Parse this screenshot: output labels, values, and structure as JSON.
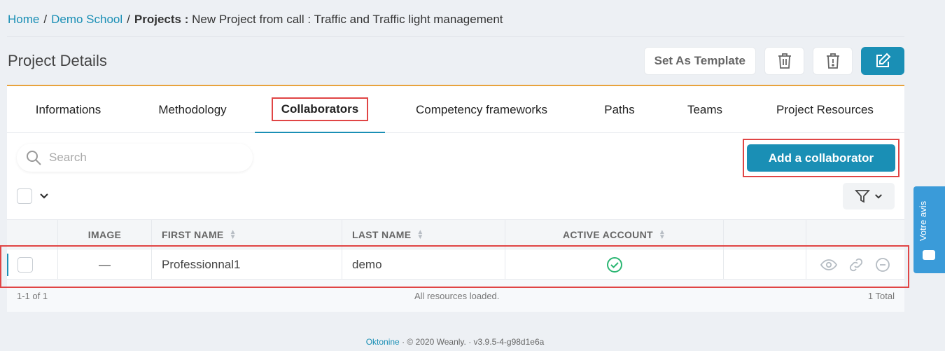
{
  "breadcrumb": {
    "home": "Home",
    "school": "Demo School",
    "section": "Projects :",
    "current": "New Project from call : Traffic and Traffic light management"
  },
  "page": {
    "title": "Project Details"
  },
  "toolbar": {
    "template_label": "Set As Template"
  },
  "tabs": [
    {
      "label": "Informations"
    },
    {
      "label": "Methodology"
    },
    {
      "label": "Collaborators"
    },
    {
      "label": "Competency frameworks"
    },
    {
      "label": "Paths"
    },
    {
      "label": "Teams"
    },
    {
      "label": "Project Resources"
    }
  ],
  "active_tab": "Collaborators",
  "search": {
    "placeholder": "Search"
  },
  "add_button": "Add a collaborator",
  "table": {
    "headers": [
      "IMAGE",
      "FIRST NAME",
      "LAST NAME",
      "ACTIVE ACCOUNT"
    ],
    "rows": [
      {
        "image": "—",
        "first_name": "Professionnal1",
        "last_name": "demo",
        "active": true
      }
    ],
    "footer": {
      "range": "1-1 of 1",
      "status": "All resources loaded.",
      "total": "1 Total"
    }
  },
  "footer": {
    "brand": "Oktonine",
    "copyright": "© 2020 Weanly.",
    "version": "v3.9.5-4-g98d1e6a"
  },
  "feedback": {
    "label": "Votre avis"
  },
  "colors": {
    "accent": "#1a8fb5",
    "highlight": "#e04545",
    "tab_top": "#e8a33d",
    "success": "#2bb673"
  }
}
